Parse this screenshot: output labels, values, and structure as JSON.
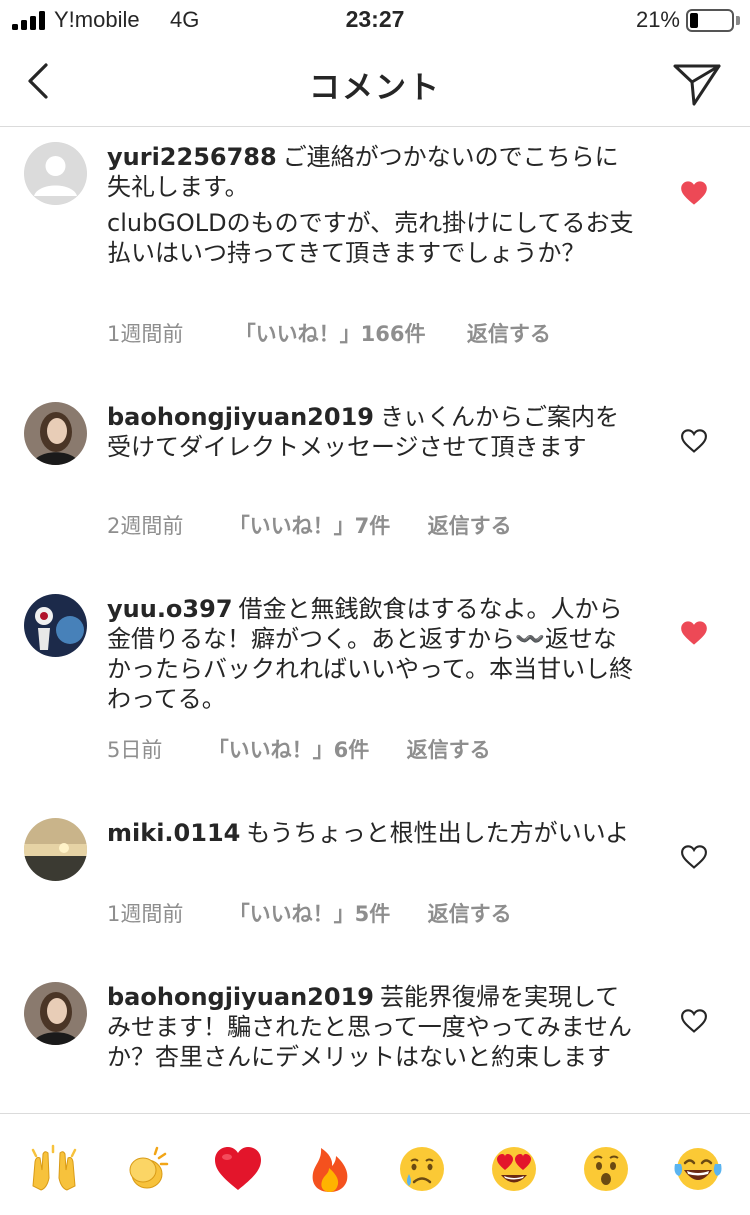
{
  "status": {
    "carrier": "Y!mobile",
    "network": "4G",
    "time": "23:27",
    "battery": "21%",
    "battery_level": 0.21
  },
  "header": {
    "title": "コメント",
    "back_icon": "chevron-left-icon",
    "share_icon": "paper-plane-icon"
  },
  "comments": [
    {
      "username": "yuri2256788",
      "text": "ご連絡がつかないのでこちらに失礼します。",
      "text2": "clubGOLDのものですが、売れ掛けにしてるお支払いはいつ持ってきて頂きますでしょうか？",
      "time": "1週間前",
      "likes": "「いいね！」166件",
      "reply": "返信する",
      "liked": true
    },
    {
      "username": "baohongjiyuan2019",
      "text": "きぃくんからご案内を受けてダイレクトメッセージさせて頂きます",
      "time": "2週間前",
      "likes": "「いいね！」7件",
      "reply": "返信する",
      "liked": false
    },
    {
      "username": "yuu.o397",
      "text": "借金と無銭飲食はするなよ。人から金借りるな！癖がつく。あと返すから〰️返せなかったらバックれればいいやって。本当甘いし終わってる。",
      "time": "5日前",
      "likes": "「いいね！」6件",
      "reply": "返信する",
      "liked": true
    },
    {
      "username": "miki.0114",
      "text": "もうちょっと根性出した方がいいよ",
      "time": "1週間前",
      "likes": "「いいね！」5件",
      "reply": "返信する",
      "liked": false
    },
    {
      "username": "baohongjiyuan2019",
      "text": "芸能界復帰を実現してみせます！騙されたと思って一度やってみませんか？杏里さんにデメリットはないと約束します",
      "liked": false
    }
  ],
  "emoji_bar": [
    "🙌",
    "👏",
    "❤️",
    "🔥",
    "😢",
    "😍",
    "😮",
    "😂"
  ],
  "colors": {
    "heart_liked": "#ed4956",
    "meta_gray": "#8e8e8e",
    "divider": "#dbdbdb"
  }
}
